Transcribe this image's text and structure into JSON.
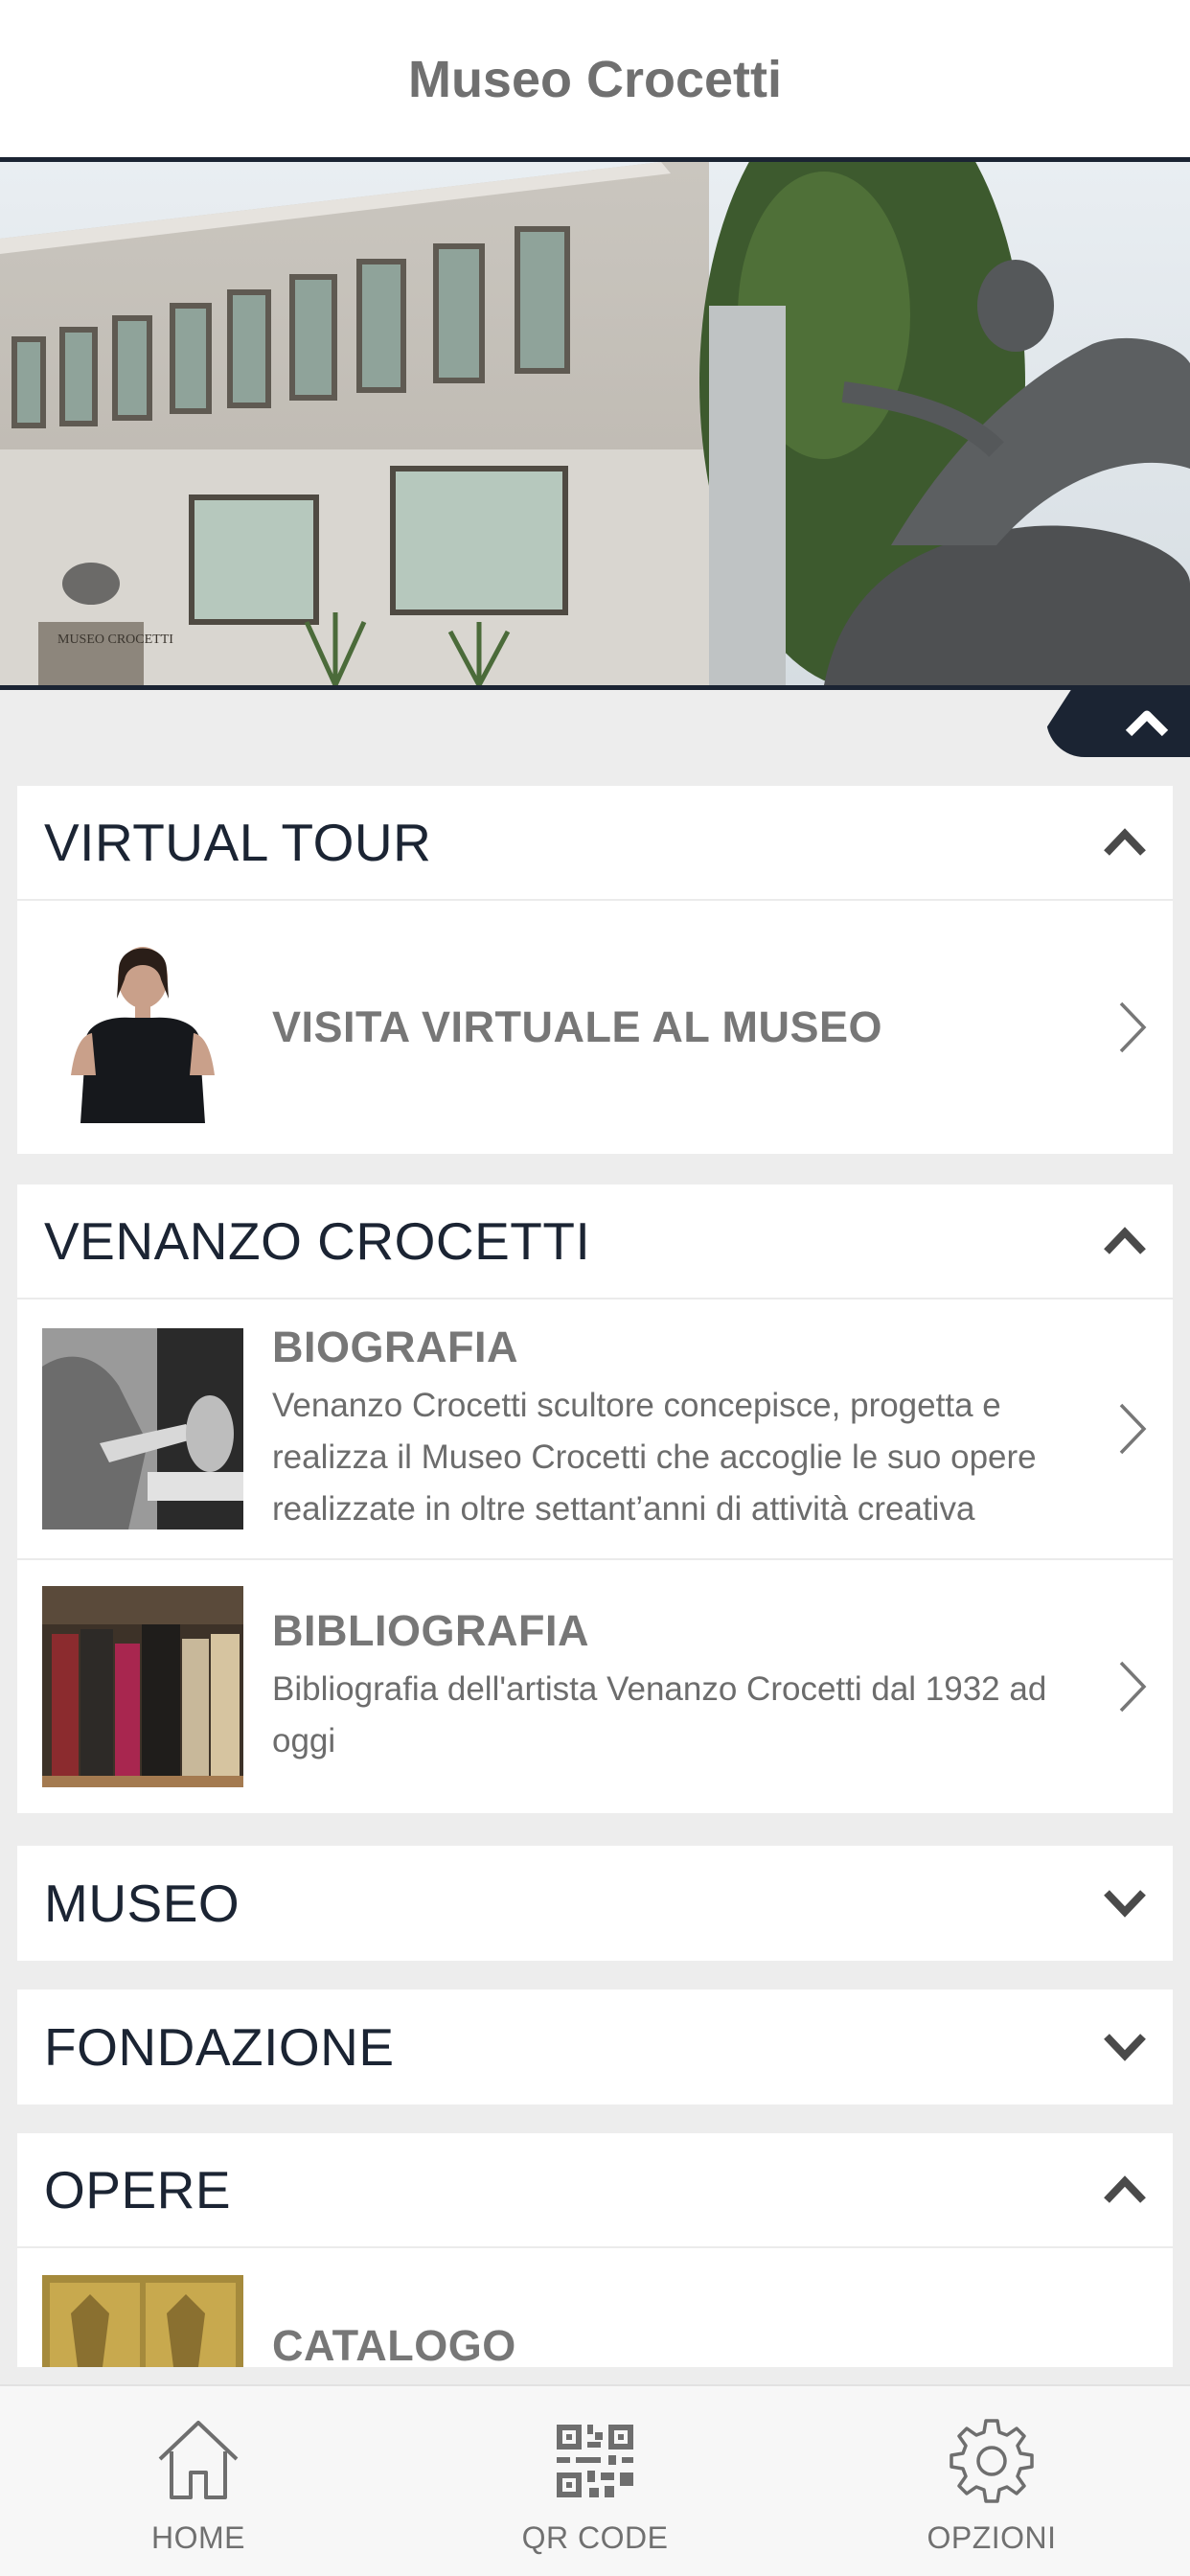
{
  "header": {
    "title": "Museo Crocetti"
  },
  "hero": {
    "sign_text": "MUSEO CROCETTI"
  },
  "sections": {
    "virtual_tour": {
      "title": "VIRTUAL TOUR",
      "expanded": true,
      "items": [
        {
          "title": "VISITA VIRTUALE AL MUSEO",
          "description": ""
        }
      ]
    },
    "venanzo": {
      "title": "VENANZO CROCETTI",
      "expanded": true,
      "items": [
        {
          "title": "BIOGRAFIA",
          "description": "Venanzo Crocetti scultore concepisce, progetta e realizza il Museo Crocetti che accoglie le suo opere realizzate in oltre settant’anni di attività creativa"
        },
        {
          "title": "BIBLIOGRAFIA",
          "description": "Bibliografia dell'artista Venanzo Crocetti dal 1932 ad oggi"
        }
      ]
    },
    "museo": {
      "title": "MUSEO",
      "expanded": false
    },
    "fondazione": {
      "title": "FONDAZIONE",
      "expanded": false
    },
    "opere": {
      "title": "OPERE",
      "expanded": true,
      "items": [
        {
          "title": "CATALOGO",
          "description": ""
        }
      ]
    }
  },
  "tabbar": {
    "home": "HOME",
    "qr": "QR CODE",
    "options": "OPZIONI"
  },
  "colors": {
    "dark": "#1b2433",
    "text_gray": "#777777",
    "background": "#ededed"
  },
  "icons": [
    "chevron-up-icon",
    "chevron-down-icon",
    "chevron-right-icon",
    "home-icon",
    "qr-code-icon",
    "gear-icon"
  ]
}
